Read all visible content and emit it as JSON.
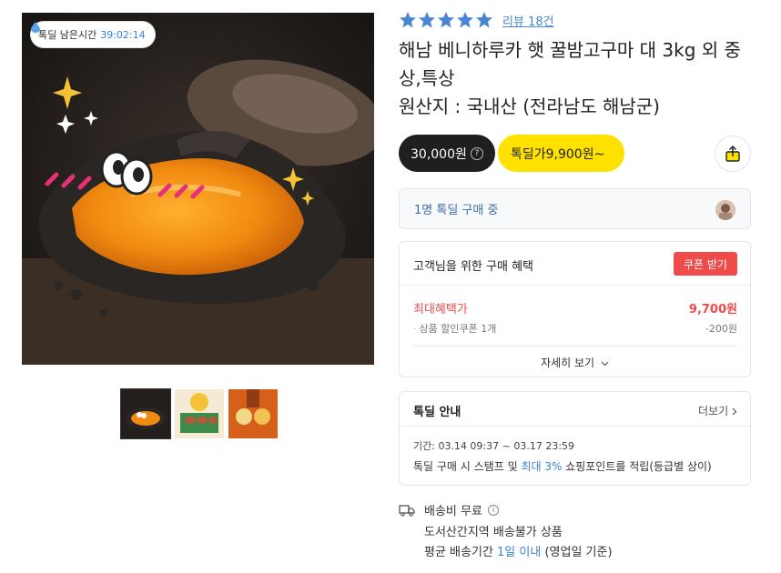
{
  "timer": {
    "label": "톡딜 남은시간",
    "value": "39:02:14"
  },
  "product": {
    "rating_stars": 5,
    "review_link": "리뷰 18건",
    "title": "해남 베니하루카 햇 꿀밤고구마 대 3kg 외 중상,특상",
    "origin": "원산지 : 국내산 (전라남도 해남군)"
  },
  "price": {
    "normal": "30,000원",
    "deal": "톡딜가9,900원~"
  },
  "buyers": {
    "text": "1명 톡딜 구매 중"
  },
  "benefit": {
    "title": "고객님을 위한 구매 혜택",
    "coupon_button": "쿠폰 받기",
    "max_label": "최대혜택가",
    "max_value": "9,700원",
    "coupon_line": "상품 할인쿠폰 1개",
    "coupon_amount": "-200원",
    "detail_link": "자세히 보기"
  },
  "deal_info": {
    "title": "톡딜 안내",
    "more": "더보기",
    "period": "기간: 03.14 09:37 ~ 03.17 23:59",
    "stamp_prefix": "톡딜 구매 시 스탬프 및 ",
    "stamp_highlight": "최대 3%",
    "stamp_suffix": " 쇼핑포인트를 적립(등급별 상이)"
  },
  "shipping": {
    "fee": "배송비 무료",
    "island": "도서산간지역 배송불가 상품",
    "period_prefix": "평균 배송기간 ",
    "period_highlight": "1일 이내",
    "period_suffix": " (영업일 기준)"
  },
  "colors": {
    "accent_blue": "#3b7fd9",
    "star_blue": "#4a86d4",
    "deal_yellow": "#ffe100",
    "coupon_red": "#f04b4b",
    "dark_pill": "#1f1f1f"
  },
  "icons": [
    "water-drop-icon",
    "star-icon",
    "question-icon",
    "share-icon",
    "chevron-down-icon",
    "chevron-right-icon",
    "truck-icon",
    "info-icon"
  ]
}
